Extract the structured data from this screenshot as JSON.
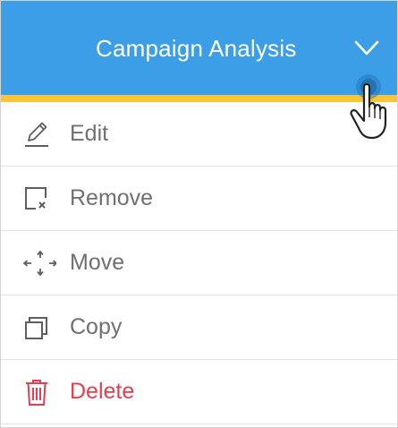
{
  "header": {
    "title": "Campaign Analysis",
    "toggle_icon": "chevron-down-icon",
    "background": "#3d9ee8",
    "accent_color": "#f6c53a"
  },
  "menu": {
    "items": [
      {
        "label": "Edit",
        "icon": "pencil-icon"
      },
      {
        "label": "Remove",
        "icon": "remove-box-icon"
      },
      {
        "label": "Move",
        "icon": "move-arrows-icon"
      },
      {
        "label": "Copy",
        "icon": "copy-icon"
      },
      {
        "label": "Delete",
        "icon": "trash-icon",
        "color": "#e53e4f"
      }
    ]
  },
  "cursor": {
    "icon": "hand-pointer-icon"
  }
}
